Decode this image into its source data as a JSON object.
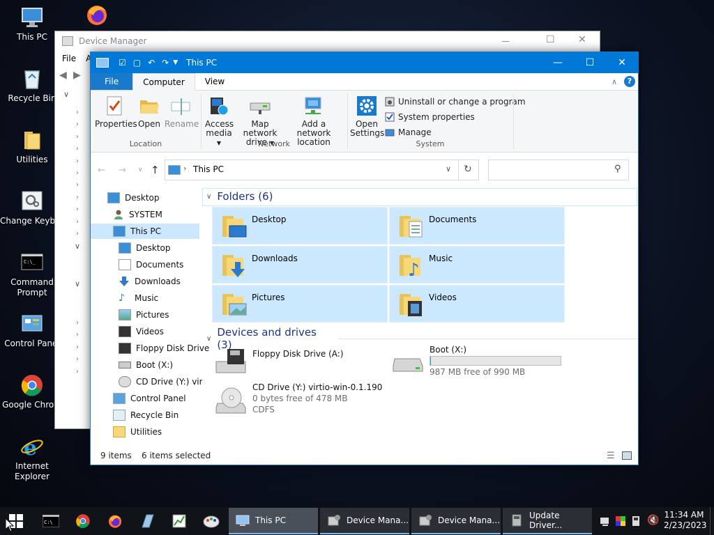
{
  "desktop": {
    "icons": [
      {
        "label": "This PC"
      },
      {
        "label": "Recycle Bin"
      },
      {
        "label": "Utilities"
      },
      {
        "label": "Change Keyboard Layo"
      },
      {
        "label": "Command Prompt"
      },
      {
        "label": "Control Panel"
      },
      {
        "label": "Google Chrom"
      },
      {
        "label": "Internet Explorer"
      }
    ]
  },
  "device_manager": {
    "title": "Device Manager",
    "menu_file": "File",
    "menu_action": "A"
  },
  "explorer": {
    "title": "This PC",
    "tabs": {
      "file": "File",
      "computer": "Computer",
      "view": "View"
    },
    "ribbon": {
      "properties": "Properties",
      "open": "Open",
      "rename": "Rename",
      "access_media": "Access",
      "access_media2": "media",
      "map_network": "Map network",
      "map_network2": "drive",
      "add_network": "Add a network",
      "add_network2": "location",
      "open_settings": "Open",
      "open_settings2": "Settings",
      "uninstall": "Uninstall or change a program",
      "system_properties": "System properties",
      "manage": "Manage",
      "group_location": "Location",
      "group_network": "Network",
      "group_system": "System"
    },
    "address": {
      "path": "This PC",
      "search_placeholder": ""
    },
    "nav": [
      {
        "label": "Desktop"
      },
      {
        "label": "SYSTEM"
      },
      {
        "label": "This PC"
      },
      {
        "label": "Desktop"
      },
      {
        "label": "Documents"
      },
      {
        "label": "Downloads"
      },
      {
        "label": "Music"
      },
      {
        "label": "Pictures"
      },
      {
        "label": "Videos"
      },
      {
        "label": "Floppy Disk Drive"
      },
      {
        "label": "Boot (X:)"
      },
      {
        "label": "CD Drive (Y:) virtic"
      },
      {
        "label": "Control Panel"
      },
      {
        "label": "Recycle Bin"
      },
      {
        "label": "Utilities"
      }
    ],
    "folders_header": "Folders (6)",
    "folders": [
      {
        "label": "Desktop"
      },
      {
        "label": "Documents"
      },
      {
        "label": "Downloads"
      },
      {
        "label": "Music"
      },
      {
        "label": "Pictures"
      },
      {
        "label": "Videos"
      }
    ],
    "drives_header": "Devices and drives (3)",
    "drives": {
      "floppy": {
        "name": "Floppy Disk Drive (A:)"
      },
      "boot": {
        "name": "Boot (X:)",
        "free": "987 MB free of 990 MB",
        "used_fraction": 0.003
      },
      "cd": {
        "name": "CD Drive (Y:) virtio-win-0.1.190",
        "free": "0 bytes free of 478 MB",
        "fs": "CDFS"
      }
    },
    "status": {
      "items": "9 items",
      "selected": "6 items selected"
    }
  },
  "taskbar": {
    "tasks": [
      {
        "label": "This PC"
      },
      {
        "label": "Device Mana..."
      },
      {
        "label": "Device Mana..."
      },
      {
        "label": "Update Driver..."
      }
    ],
    "time": "11:34 AM",
    "date": "2/23/2023"
  },
  "colors": {
    "accent": "#0078d7",
    "selection": "#cce8ff",
    "taskbar": "#101418"
  }
}
